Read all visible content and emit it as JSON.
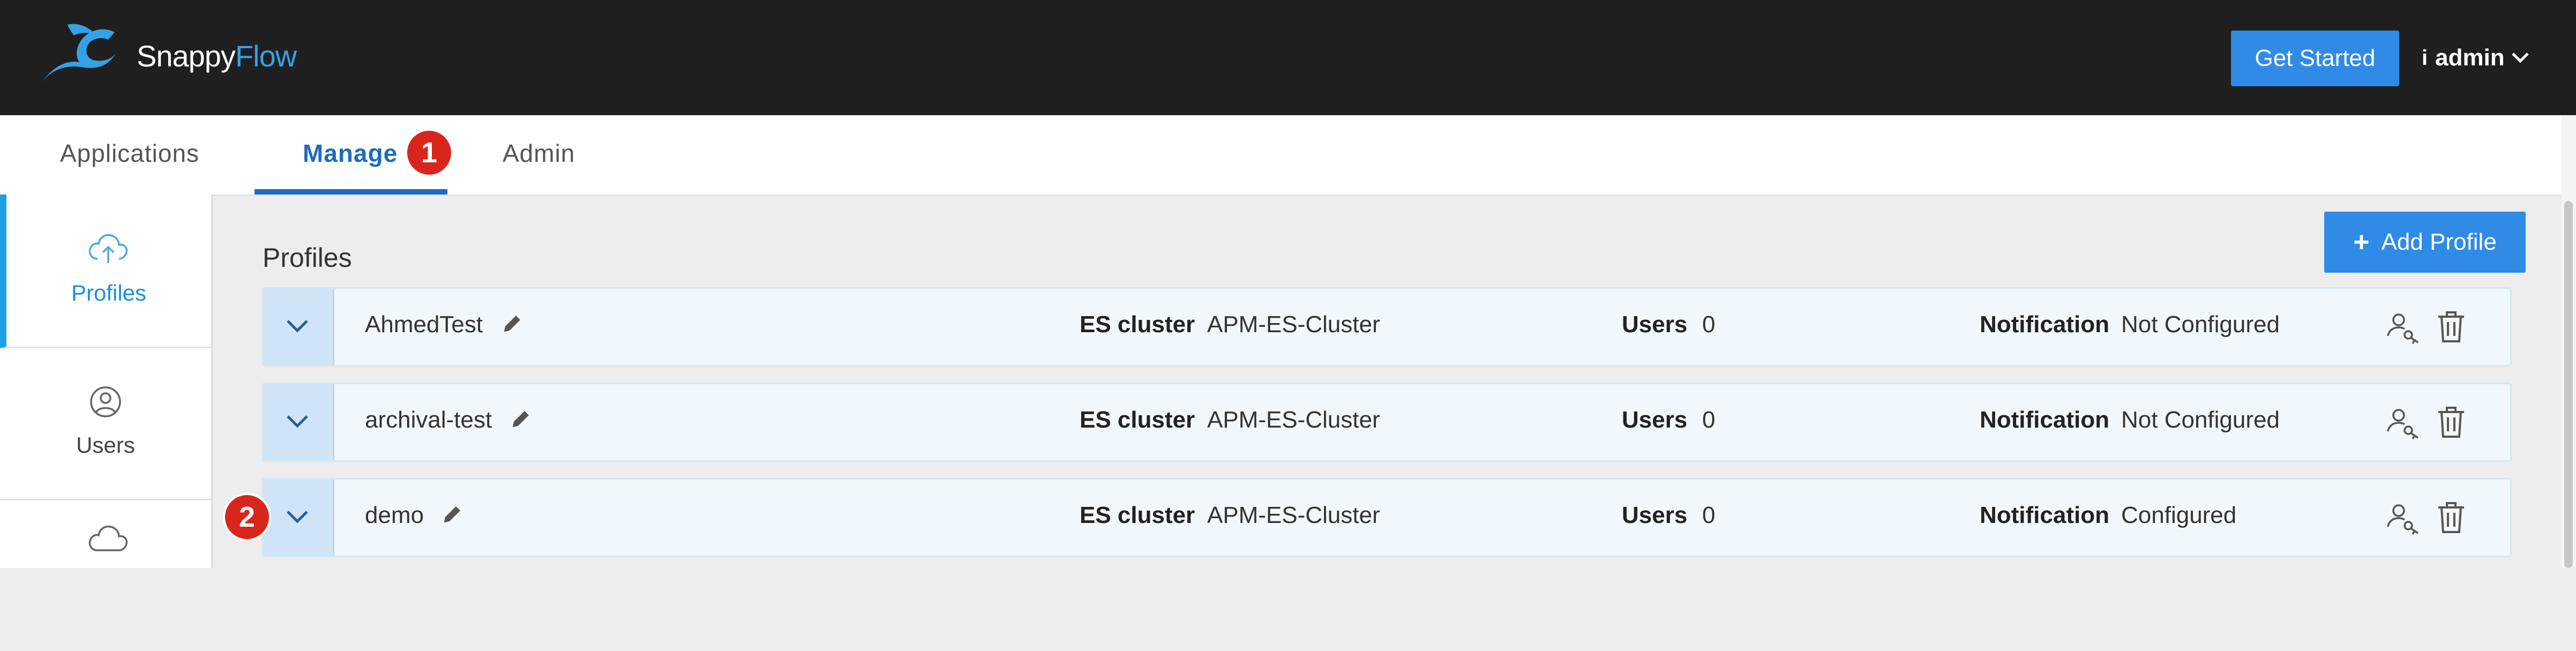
{
  "app": {
    "brand_part1": "Snappy",
    "brand_part2": "Flow"
  },
  "header": {
    "get_started_label": "Get Started",
    "info_glyph": "i",
    "user_label": "admin"
  },
  "tabs": [
    {
      "label": "Applications"
    },
    {
      "label": "Manage",
      "active": true
    },
    {
      "label": "Admin"
    }
  ],
  "markers": [
    "1",
    "2"
  ],
  "sidebar": {
    "items": [
      {
        "label": "Profiles",
        "icon": "cloud-upload-icon",
        "active": true
      },
      {
        "label": "Users",
        "icon": "user-circle-icon"
      },
      {
        "label": "",
        "icon": "cloud-icon"
      }
    ]
  },
  "main": {
    "title": "Profiles",
    "add_plus": "+",
    "add_label": "Add Profile",
    "labels": {
      "es_cluster": "ES cluster",
      "users": "Users",
      "notification": "Notification"
    },
    "profiles": [
      {
        "name": "AhmedTest",
        "es_cluster": "APM-ES-Cluster",
        "users": "0",
        "notification": "Not Configured"
      },
      {
        "name": "archival-test",
        "es_cluster": "APM-ES-Cluster",
        "users": "0",
        "notification": "Not Configured"
      },
      {
        "name": "demo",
        "es_cluster": "APM-ES-Cluster",
        "users": "0",
        "notification": "Configured"
      }
    ]
  },
  "colors": {
    "topbar": "#1f1f1f",
    "accent": "#2f8be6",
    "active_tab": "#1e6bbd",
    "marker": "#d9261c"
  }
}
